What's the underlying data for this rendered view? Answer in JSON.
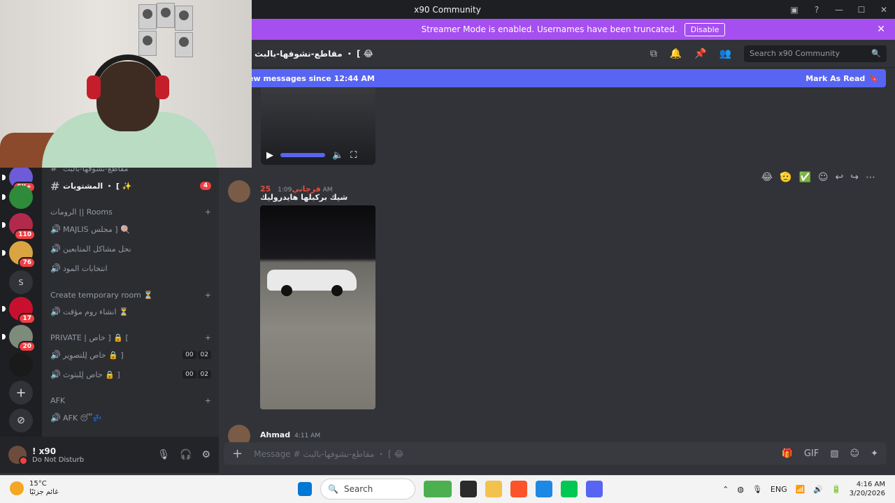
{
  "window": {
    "title": "x90 Community"
  },
  "banner": {
    "text": "Streamer Mode is enabled. Usernames have been truncated.",
    "disable_label": "Disable"
  },
  "header": {
    "channel_name": "مقاطع-نشوفها-بالبث ・ [ 😂",
    "search_placeholder": "Search x90 Community"
  },
  "new_messages": {
    "text": "ew messages since 12:44 AM",
    "mark_read": "Mark As Read"
  },
  "servers": [
    {
      "badge": "8K+",
      "color": "#6e5bd8"
    },
    {
      "badge": "",
      "color": "#2e8b3a"
    },
    {
      "badge": "110",
      "color": "#b22a4b"
    },
    {
      "badge": "76",
      "color": "#d9a441"
    },
    {
      "badge": "",
      "label": "S",
      "color": "#313338"
    },
    {
      "badge": "17",
      "color": "#c8102e"
    },
    {
      "badge": "20",
      "color": "#7d8b7a"
    },
    {
      "badge": "",
      "color": "#1a1a1a"
    }
  ],
  "sidebar": {
    "top_partial": "مقاطع-نشوفها-بالبث",
    "chan_top": {
      "name": "المشتويات ・ [ ✨",
      "badge": "4"
    },
    "rooms_category": "الرومات || Rooms",
    "rooms": [
      {
        "name": "MAJLIS مجلس ] 🍭",
        "icon": "🔊"
      },
      {
        "name": "نحل مشاكل المتابعين",
        "icon": "🔊"
      },
      {
        "name": "انتخابات المود",
        "icon": "🔊"
      }
    ],
    "temp_category": "Create temporary room ⏳",
    "temp_rooms": [
      {
        "name": "انشاء روم مؤقت ⏳",
        "icon": "🔊"
      }
    ],
    "private_category": "PRIVATE | خاص ] 🔒 [",
    "private_rooms": [
      {
        "name": "خاص لِلتصوِير 🔒 ]",
        "icon": "🔊",
        "c1": "00",
        "c2": "02"
      },
      {
        "name": "خاص لِلبثوث 🔒 ]",
        "icon": "🔊",
        "c1": "00",
        "c2": "02"
      }
    ],
    "afk_category": "AFK",
    "afk_rooms": [
      {
        "name": "AFK 😴💤",
        "icon": "🔊"
      }
    ]
  },
  "user": {
    "name": "! x90",
    "status": "Do Not Disturb"
  },
  "messages": [
    {
      "author": "25 فرجاني",
      "time": "1:09 AM",
      "text": "شيك بركبلها هايدروليك",
      "author_color": "#e74c3c"
    },
    {
      "author": "Ahmad",
      "time": "4:11 AM",
      "text": "",
      "author_color": "#f2f3f5"
    }
  ],
  "reactions": [
    "😂",
    "🫡",
    "✅"
  ],
  "composer": {
    "placeholder": "Message # مقاطع-نشوفها-بالبث ・ [ 😂"
  },
  "taskbar": {
    "weather_temp": "15°C",
    "weather_desc": "غائم جزئيًا",
    "search_label": "Search",
    "lang": "ENG",
    "time": "4:16 AM",
    "date": "3/20/2026"
  },
  "colors": {
    "accent": "#5865f2",
    "banner": "#a54ff0",
    "dnd": "#f23f43"
  }
}
